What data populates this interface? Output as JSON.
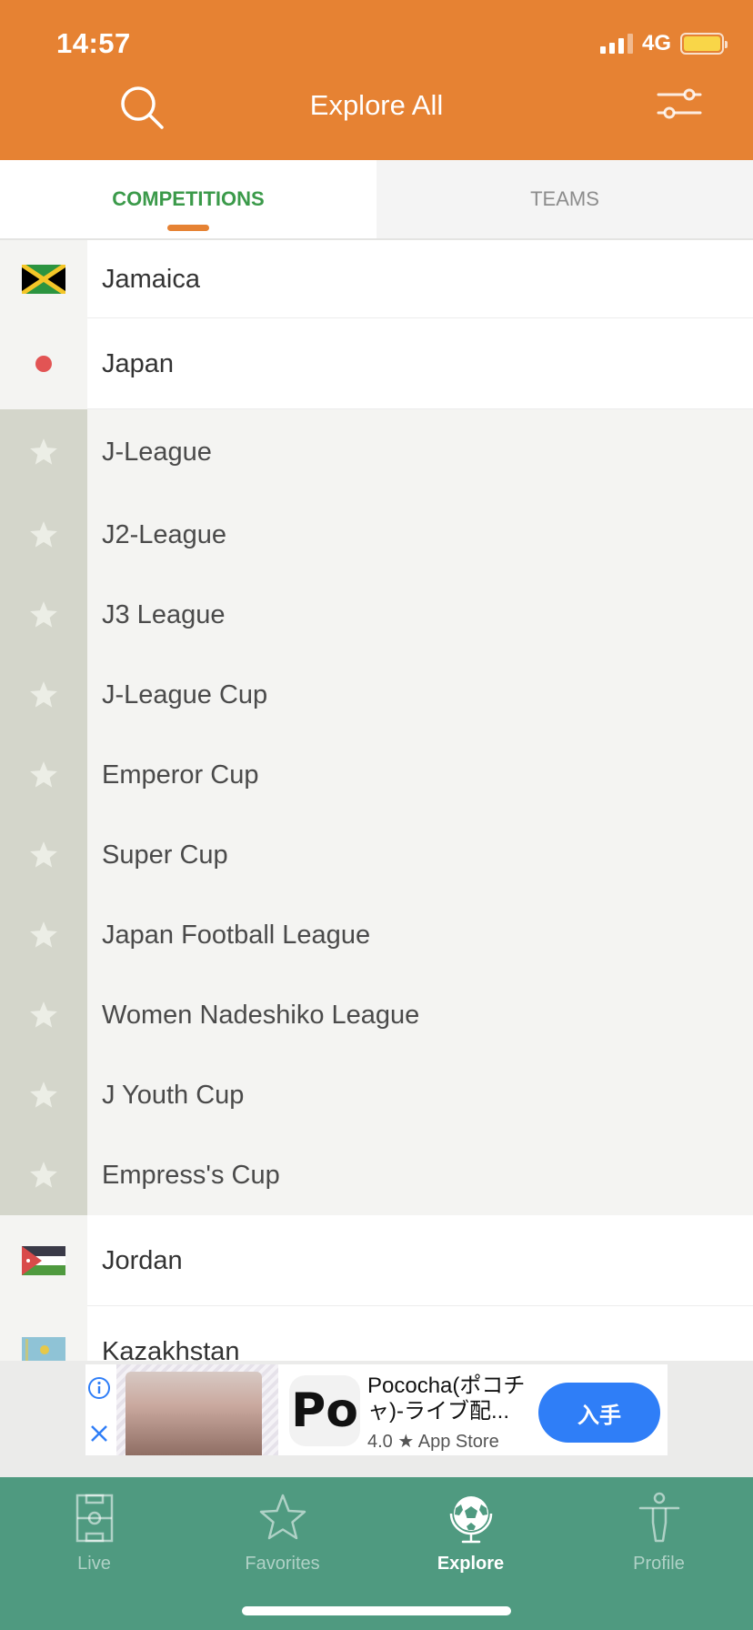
{
  "status_bar": {
    "time": "14:57",
    "network": "4G"
  },
  "header": {
    "title": "Explore All"
  },
  "tabs": [
    {
      "label": "COMPETITIONS",
      "active": true
    },
    {
      "label": "TEAMS",
      "active": false
    }
  ],
  "list": [
    {
      "type": "country",
      "label": "Jamaica",
      "icon": "jamaica-flag"
    },
    {
      "type": "country",
      "label": "Japan",
      "icon": "japan-flag"
    },
    {
      "type": "league",
      "label": "J-League"
    },
    {
      "type": "league",
      "label": "J2-League"
    },
    {
      "type": "league",
      "label": "J3 League"
    },
    {
      "type": "league",
      "label": "J-League Cup"
    },
    {
      "type": "league",
      "label": "Emperor Cup"
    },
    {
      "type": "league",
      "label": "Super Cup"
    },
    {
      "type": "league",
      "label": "Japan Football League"
    },
    {
      "type": "league",
      "label": "Women Nadeshiko League"
    },
    {
      "type": "league",
      "label": "J Youth Cup"
    },
    {
      "type": "league",
      "label": "Empress's Cup"
    },
    {
      "type": "country",
      "label": "Jordan",
      "icon": "jordan-flag"
    },
    {
      "type": "country",
      "label": "Kazakhstan",
      "icon": "kazakhstan-flag"
    }
  ],
  "ad": {
    "title": "Pococha(ポコチャ)-ライブ配...",
    "rating_text": "4.0 ★ App Store",
    "cta": "入手",
    "logo_text": "Po"
  },
  "bottom_nav": [
    {
      "label": "Live",
      "icon": "pitch-icon",
      "active": false
    },
    {
      "label": "Favorites",
      "icon": "star-icon",
      "active": false
    },
    {
      "label": "Explore",
      "icon": "globe-ball-icon",
      "active": true
    },
    {
      "label": "Profile",
      "icon": "player-icon",
      "active": false
    }
  ],
  "colors": {
    "header": "#e68233",
    "active_tab": "#3b9a4a",
    "nav": "#4f9a80",
    "cta": "#2f7ef7"
  }
}
